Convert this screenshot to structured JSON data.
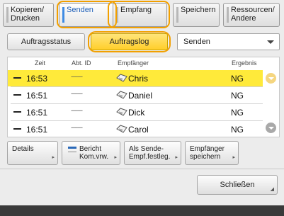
{
  "tabs": [
    {
      "label": "Kopieren/\nDrucken",
      "active": false
    },
    {
      "label": "Senden",
      "active": true
    },
    {
      "label": "Empfang",
      "active": false
    },
    {
      "label": "Speichern",
      "active": false
    },
    {
      "label": "Ressourcen/\nAndere",
      "active": false
    }
  ],
  "subtabs": {
    "status_label": "Auftragsstatus",
    "log_label": "Auftragslog",
    "dropdown_value": "Senden"
  },
  "table": {
    "headers": {
      "zeit": "Zeit",
      "abt_id": "Abt. ID",
      "empfaenger": "Empfänger",
      "ergebnis": "Ergebnis"
    },
    "rows": [
      {
        "time": "16:53",
        "abt": "--------",
        "name": "Chris",
        "result": "NG",
        "selected": true
      },
      {
        "time": "16:51",
        "abt": "--------",
        "name": "Daniel",
        "result": "NG",
        "selected": false
      },
      {
        "time": "16:51",
        "abt": "--------",
        "name": "Dick",
        "result": "NG",
        "selected": false
      },
      {
        "time": "16:51",
        "abt": "--------",
        "name": "Carol",
        "result": "NG",
        "selected": false
      }
    ]
  },
  "actions": {
    "details": "Details",
    "bericht": "Bericht\nKom.vrw.",
    "als_sende": "Als Sende-\nEmpf.festleg.",
    "empfaenger_speichern": "Empfänger\nspeichern"
  },
  "close_label": "Schließen",
  "colors": {
    "highlight": "#f2a000",
    "selection": "#ffea3a",
    "accent": "#3f8be3"
  }
}
